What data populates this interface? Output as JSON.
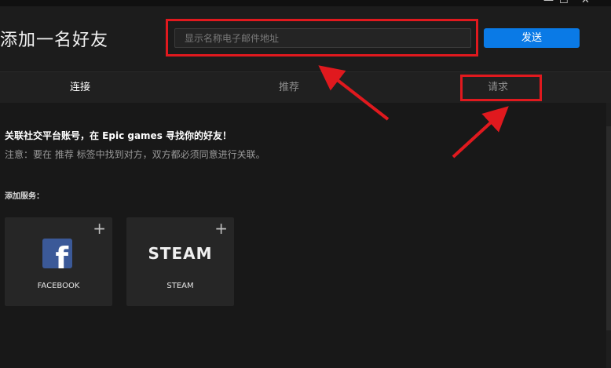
{
  "window": {
    "controls": [
      "—",
      "☐",
      "✕"
    ]
  },
  "header": {
    "title": "添加一名好友",
    "search_placeholder": "显示名称电子邮件地址",
    "send_label": "发送"
  },
  "tabs": [
    {
      "label": "连接",
      "active": true
    },
    {
      "label": "推荐",
      "active": false
    },
    {
      "label": "请求",
      "active": false
    }
  ],
  "main": {
    "intro": "关联社交平台账号，在 Epic games 寻找你的好友！",
    "note": "注意：要在 推荐 标签中找到对方，双方都必须同意进行关联。",
    "services_label": "添加服务：",
    "services": [
      {
        "name": "FACEBOOK",
        "logo_text": "f"
      },
      {
        "name": "STEAM",
        "logo_text": "STEAM"
      }
    ]
  },
  "colors": {
    "accent": "#0a7ae6",
    "annotation": "#e0191e",
    "facebook": "#3b5998"
  }
}
